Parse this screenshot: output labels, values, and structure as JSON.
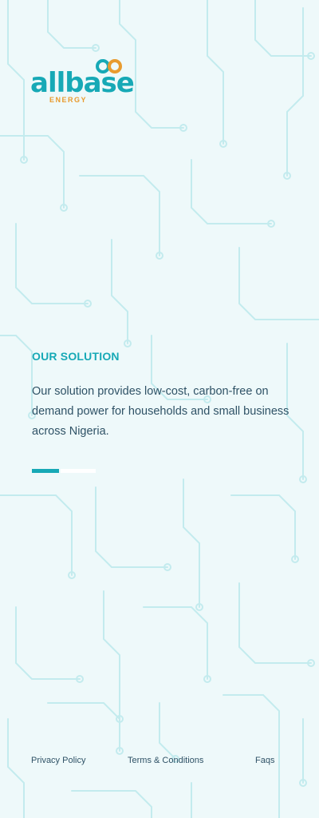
{
  "brand": {
    "name": "allbase",
    "tagline": "ENERGY",
    "primary_color": "#17a9b6",
    "accent_color": "#e89b2f"
  },
  "solution": {
    "heading": "OUR SOLUTION",
    "description": "Our solution provides low-cost, carbon-free on demand power for households and small business across Nigeria."
  },
  "pager": {
    "total": 2,
    "active_index": 0
  },
  "footer": {
    "privacy": "Privacy Policy",
    "terms": "Terms & Conditions",
    "faqs": "Faqs"
  }
}
